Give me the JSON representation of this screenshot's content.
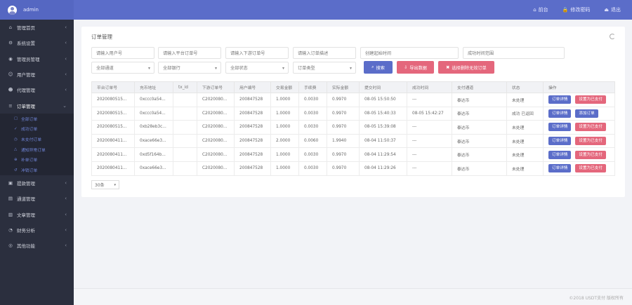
{
  "header": {
    "user": "admin",
    "actions": [
      {
        "icon": "home-icon",
        "glyph": "⌂",
        "label": "前台"
      },
      {
        "icon": "lock-icon",
        "glyph": "🔒",
        "label": "修改密码"
      },
      {
        "icon": "logout-icon",
        "glyph": "⏏",
        "label": "退出"
      }
    ]
  },
  "sidebar": {
    "items": [
      {
        "name": "sidebar-item-home",
        "glyph": "⌂",
        "label": "管理首页"
      },
      {
        "name": "sidebar-item-system-settings",
        "glyph": "⚙",
        "label": "系统设置"
      },
      {
        "name": "sidebar-item-admin-manage",
        "glyph": "◉",
        "label": "管理员管理"
      },
      {
        "name": "sidebar-item-user-manage",
        "glyph": "☺",
        "label": "用户管理"
      },
      {
        "name": "sidebar-item-agent-manage",
        "glyph": "☻",
        "label": "代理管理"
      },
      {
        "name": "sidebar-item-order-manage",
        "glyph": "≡",
        "label": "订单管理"
      }
    ],
    "submenu": [
      {
        "name": "submenu-all-orders",
        "label": "全部订单"
      },
      {
        "name": "submenu-success-orders",
        "label": "成功订单"
      },
      {
        "name": "submenu-unpaid-orders",
        "label": "未支付订单"
      },
      {
        "name": "submenu-notify-failed-orders",
        "label": "通知异常订单"
      },
      {
        "name": "submenu-supplement-orders",
        "label": "补单订单"
      },
      {
        "name": "submenu-refund-orders",
        "label": "冲销订单"
      }
    ],
    "items_after": [
      {
        "name": "sidebar-item-withdraw-manage",
        "glyph": "▣",
        "label": "提款管理"
      },
      {
        "name": "sidebar-item-channel-manage",
        "glyph": "▤",
        "label": "通道管理"
      },
      {
        "name": "sidebar-item-article-manage",
        "glyph": "▥",
        "label": "文章管理"
      },
      {
        "name": "sidebar-item-finance-analysis",
        "glyph": "◔",
        "label": "财务分析"
      },
      {
        "name": "sidebar-item-other-functions",
        "glyph": "◎",
        "label": "其他功能"
      }
    ]
  },
  "main": {
    "title": "订单管理",
    "filters": {
      "user_id_placeholder": "请输入用户号",
      "platform_order_placeholder": "请输入平台订单号",
      "downstream_order_placeholder": "请输入下游订单号",
      "order_desc_placeholder": "请输入订单描述",
      "created_start_placeholder": "创建起始时间",
      "success_time_placeholder": "成功时间范围",
      "channel_select": "全部通道",
      "bank_select": "全部银行",
      "status_select": "全部状态",
      "order_type_select": "订单类型"
    },
    "buttons": {
      "search": "搜索",
      "export": "导出数据",
      "delete_unpaid": "选择删除无效订单"
    },
    "table": {
      "columns": [
        "平台订单号",
        "充币地址",
        "tx_id",
        "下游订单号",
        "用户编号",
        "交易金额",
        "手续费",
        "实际金额",
        "提交时间",
        "成功时间",
        "支付通道",
        "状态",
        "操作"
      ],
      "detail_label": "订单详情",
      "rows": [
        {
          "order_no": "2020080515...",
          "address": "0xccc0a54...",
          "txid": "",
          "down_no": "C2020080...",
          "user_no": "200847528",
          "amount": "1.0000",
          "fee": "0.0030",
          "actual": "0.9970",
          "submit": "08-05 15:50:50",
          "success": "---",
          "channel": "泰达币",
          "status": "未处理",
          "status_type": "pending",
          "action2": "设置为已支付"
        },
        {
          "order_no": "2020080515...",
          "address": "0xccc0a54...",
          "txid": "",
          "down_no": "C2020080...",
          "user_no": "200847528",
          "amount": "1.0000",
          "fee": "0.0030",
          "actual": "0.9970",
          "submit": "08-05 15:40:33",
          "success": "08-05 15:42:27",
          "channel": "泰达币",
          "status": "成功 已返回",
          "status_type": "success",
          "action2": "添加订单"
        },
        {
          "order_no": "2020080515...",
          "address": "0xb28eb3c...",
          "txid": "",
          "down_no": "C2020080...",
          "user_no": "200847528",
          "amount": "1.0000",
          "fee": "0.0030",
          "actual": "0.9970",
          "submit": "08-05 15:39:08",
          "success": "---",
          "channel": "泰达币",
          "status": "未处理",
          "status_type": "pending",
          "action2": "设置为已支付"
        },
        {
          "order_no": "2020080411...",
          "address": "0xace66e3...",
          "txid": "",
          "down_no": "C2020080...",
          "user_no": "200847528",
          "amount": "2.0000",
          "fee": "0.0060",
          "actual": "1.9940",
          "submit": "08-04 11:50:37",
          "success": "---",
          "channel": "泰达币",
          "status": "未处理",
          "status_type": "pending",
          "action2": "设置为已支付"
        },
        {
          "order_no": "2020080411...",
          "address": "0xd5f164b...",
          "txid": "",
          "down_no": "C2020080...",
          "user_no": "200847528",
          "amount": "1.0000",
          "fee": "0.0030",
          "actual": "0.9970",
          "submit": "08-04 11:29:54",
          "success": "---",
          "channel": "泰达币",
          "status": "未处理",
          "status_type": "pending",
          "action2": "设置为已支付"
        },
        {
          "order_no": "2020080411...",
          "address": "0xace66e3...",
          "txid": "",
          "down_no": "C2020080...",
          "user_no": "200847528",
          "amount": "1.0000",
          "fee": "0.0030",
          "actual": "0.9970",
          "submit": "08-04 11:29:26",
          "success": "---",
          "channel": "泰达币",
          "status": "未处理",
          "status_type": "pending",
          "action2": "设置为已支付"
        }
      ]
    },
    "page_size": "30条"
  },
  "footer": {
    "copyright": "©2018 USDT支付 版权所有"
  },
  "colors": {
    "primary": "#5b6dc9",
    "danger": "#e4677c",
    "sidebar": "#2b2f3e",
    "success_text": "#3a9a4a",
    "error_text": "#e0404e"
  }
}
